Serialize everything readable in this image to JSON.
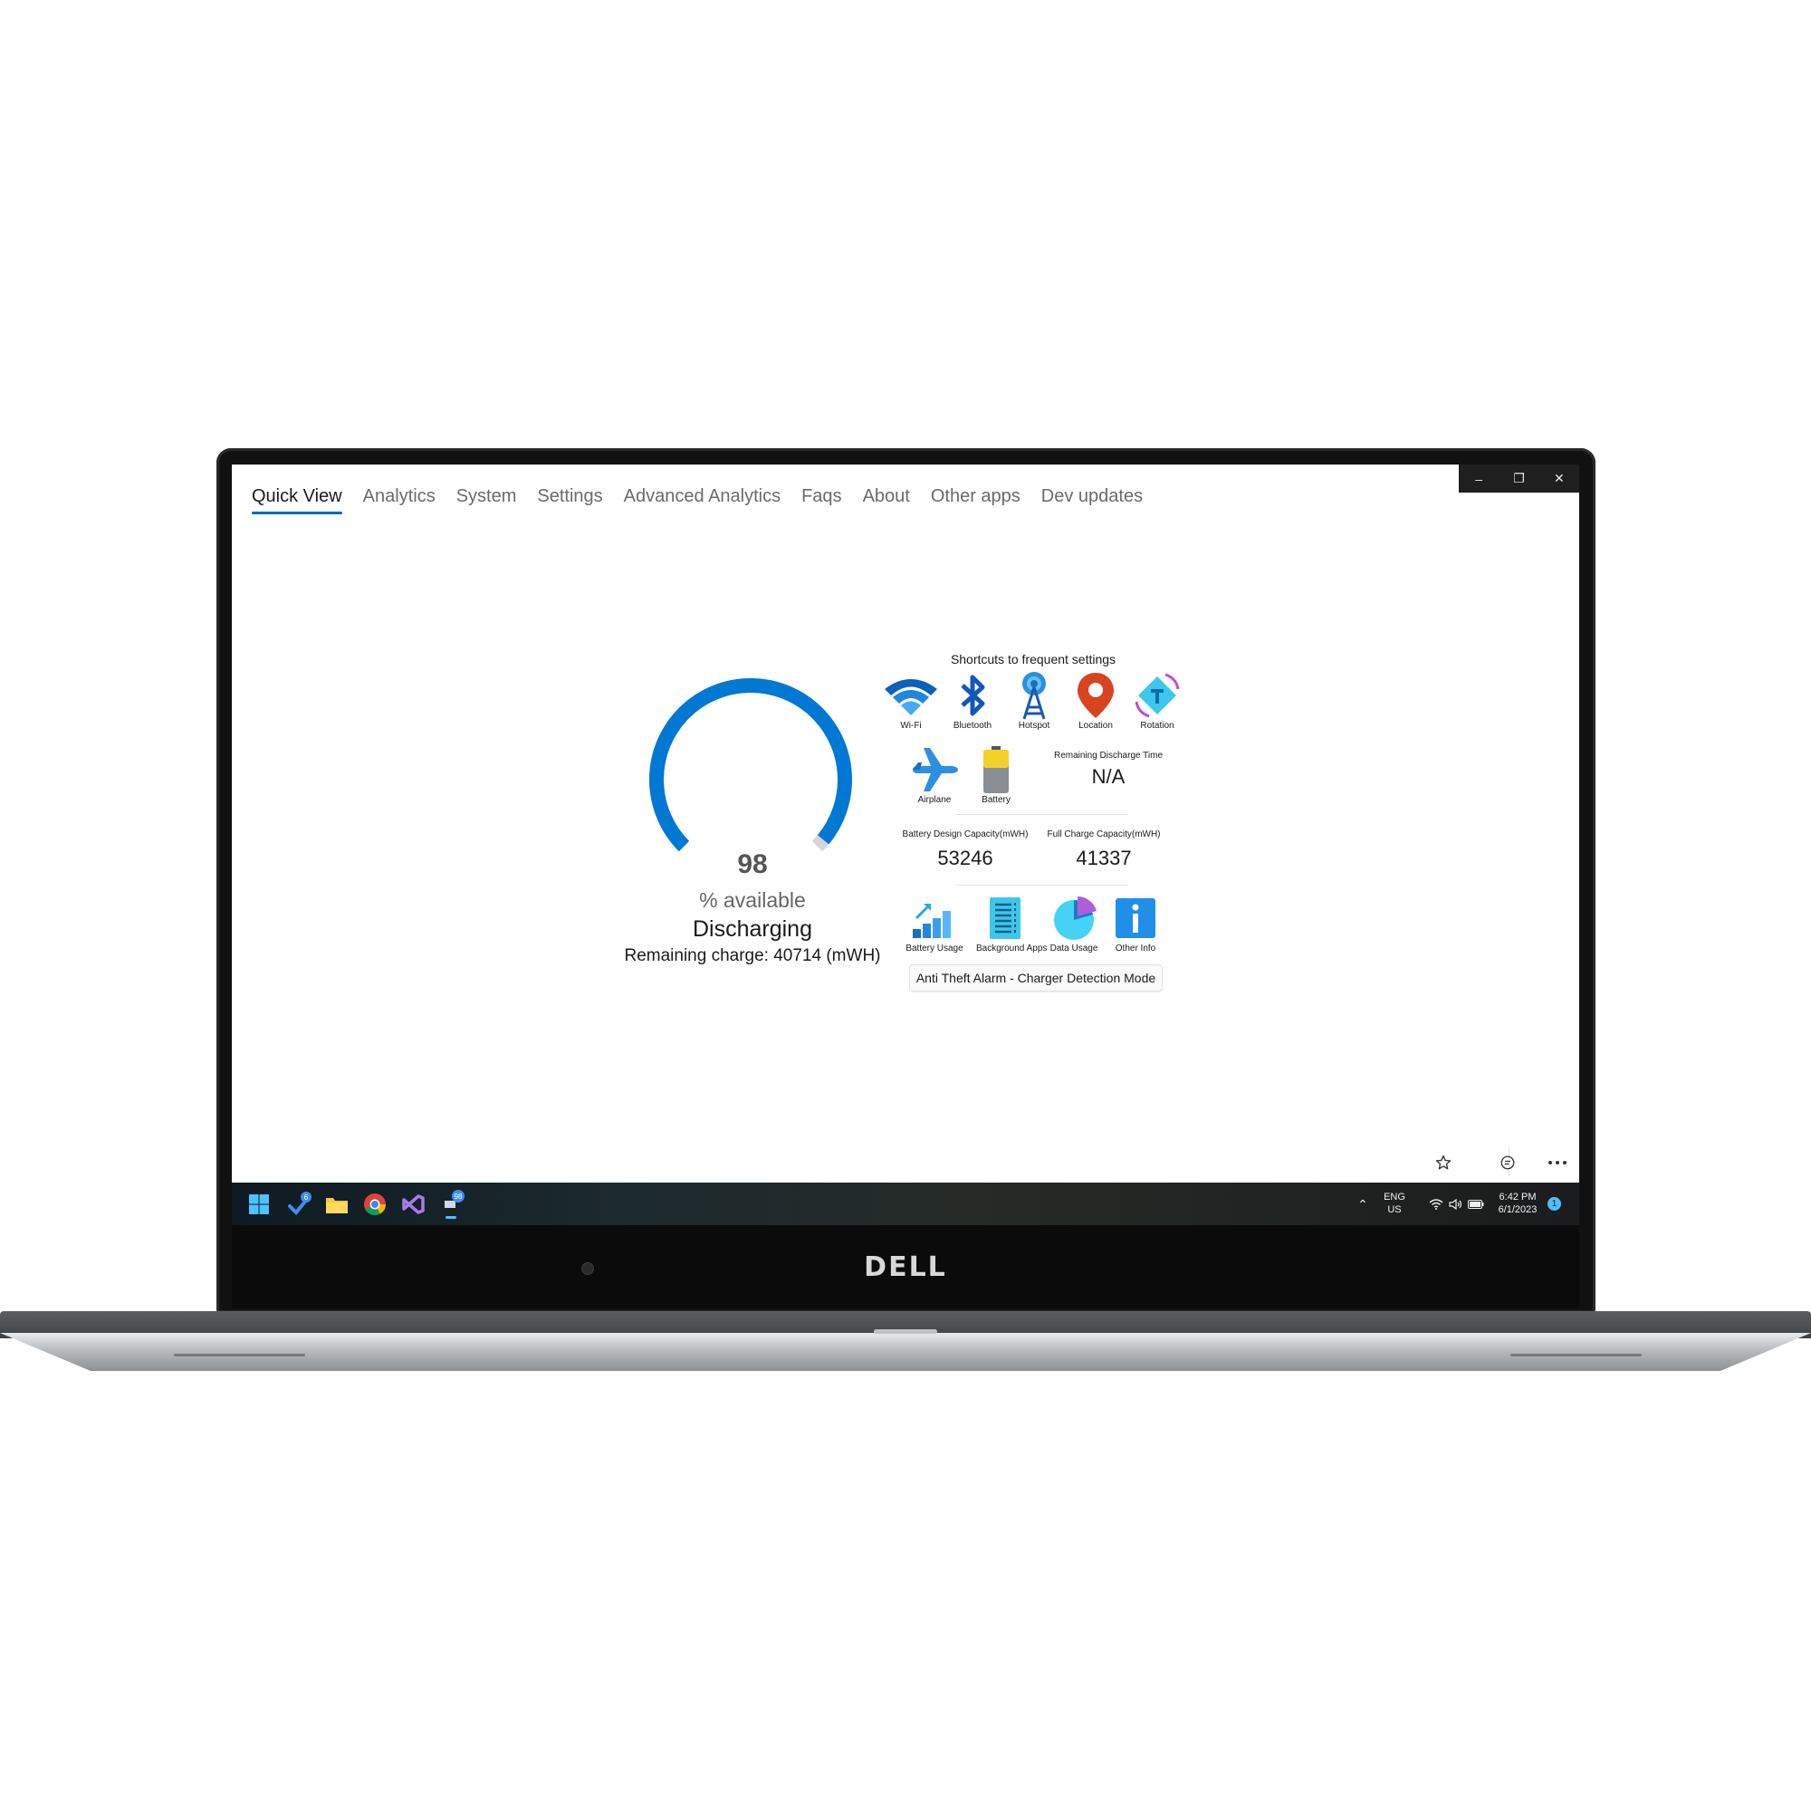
{
  "window": {
    "controls": {
      "minimize": "–",
      "restore": "❐",
      "close": "✕"
    }
  },
  "nav": {
    "tabs": [
      {
        "label": "Quick View",
        "active": true
      },
      {
        "label": "Analytics"
      },
      {
        "label": "System"
      },
      {
        "label": "Settings"
      },
      {
        "label": "Advanced Analytics"
      },
      {
        "label": "Faqs"
      },
      {
        "label": "About"
      },
      {
        "label": "Other apps"
      },
      {
        "label": "Dev updates"
      }
    ]
  },
  "battery": {
    "percent": 98,
    "percent_text": "98",
    "available_label": "% available",
    "status": "Discharging",
    "remaining_charge": "Remaining charge: 40714 (mWH)",
    "accent": "#0078d4"
  },
  "shortcuts": {
    "title": "Shortcuts to frequent settings",
    "row1": [
      {
        "label": "Wi-Fi",
        "icon": "wifi-icon"
      },
      {
        "label": "Bluetooth",
        "icon": "bluetooth-icon"
      },
      {
        "label": "Hotspot",
        "icon": "hotspot-icon"
      },
      {
        "label": "Location",
        "icon": "location-pin-icon"
      },
      {
        "label": "Rotation",
        "icon": "rotation-icon"
      }
    ],
    "row2": [
      {
        "label": "Airplane",
        "icon": "airplane-icon"
      },
      {
        "label": "Battery",
        "icon": "battery-icon"
      }
    ]
  },
  "stats": {
    "discharge_time_label": "Remaining Discharge Time",
    "discharge_time_value": "N/A",
    "design_capacity_label": "Battery Design Capacity(mWH)",
    "design_capacity_value": "53246",
    "full_charge_label": "Full Charge Capacity(mWH)",
    "full_charge_value": "41337"
  },
  "tools": [
    {
      "label": "Battery Usage",
      "icon": "battery-usage-chart-icon"
    },
    {
      "label": "Background Apps",
      "icon": "background-apps-icon"
    },
    {
      "label": "Data Usage",
      "icon": "data-usage-pie-icon"
    },
    {
      "label": "Other Info",
      "icon": "info-icon"
    }
  ],
  "anti_theft": {
    "label": "Anti Theft Alarm - Charger Detection Mode"
  },
  "appbar": {
    "icons": [
      "star-icon",
      "feedback-icon",
      "more-icon"
    ]
  },
  "taskbar": {
    "badge_tasks": "6",
    "badge_battery": "98",
    "lang_line1": "ENG",
    "lang_line2": "US",
    "time": "6:42 PM",
    "date": "6/1/2023",
    "notification_count": "1"
  },
  "device": {
    "brand": "DELL"
  }
}
